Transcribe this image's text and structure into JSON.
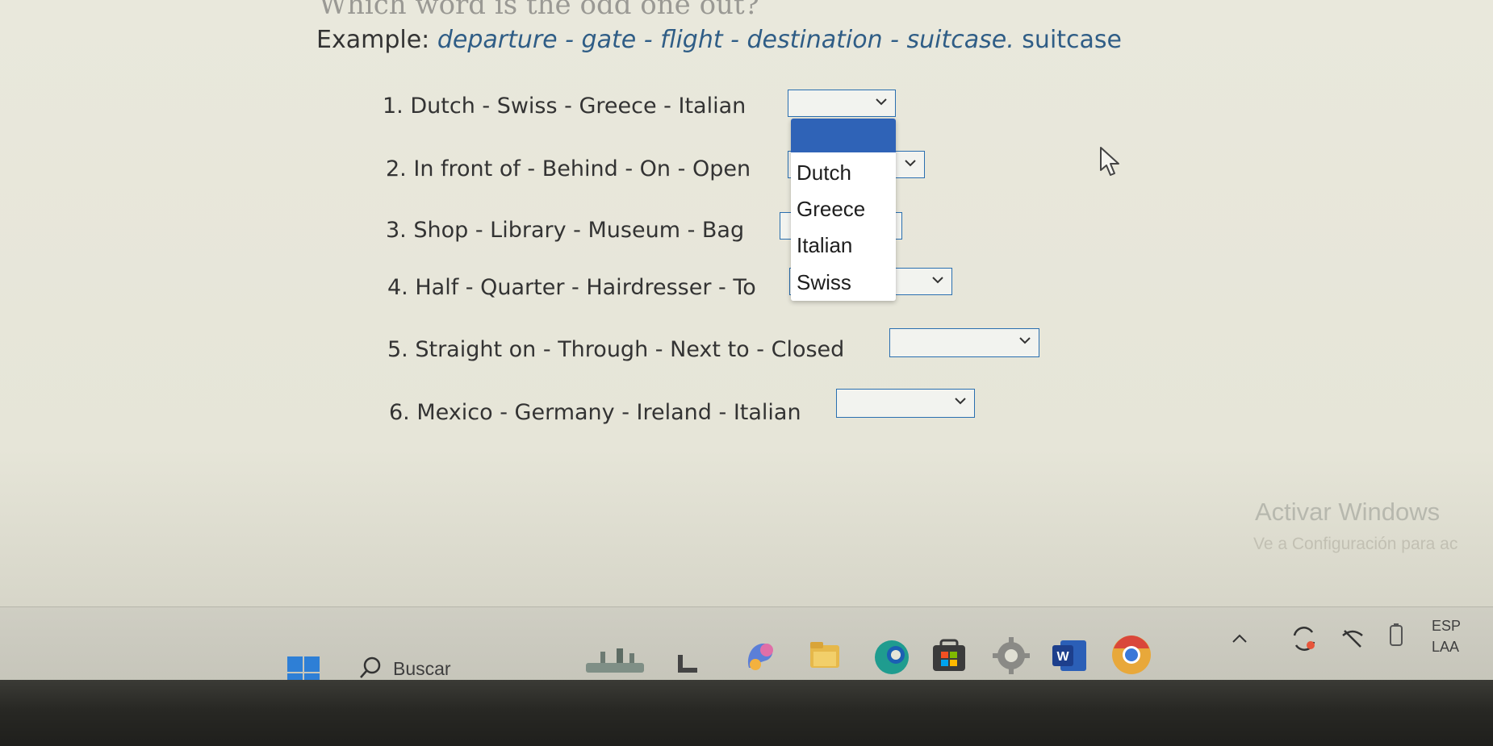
{
  "header_partial": "Which word is the odd one out?",
  "example": {
    "prefix": "Example:",
    "words": "departure - gate - flight - destination - suitcase.",
    "answer": "suitcase"
  },
  "questions": [
    {
      "number": "1.",
      "text": "Dutch - Swiss - Greece - Italian",
      "selected": ""
    },
    {
      "number": "2.",
      "text": "In front of - Behind - On - Open",
      "selected": ""
    },
    {
      "number": "3.",
      "text": "Shop - Library - Museum - Bag",
      "selected": ""
    },
    {
      "number": "4.",
      "text": "Half - Quarter - Hairdresser - To",
      "selected": ""
    },
    {
      "number": "5.",
      "text": "Straight on - Through - Next to - Closed",
      "selected": ""
    },
    {
      "number": "6.",
      "text": "Mexico - Germany - Ireland - Italian",
      "selected": ""
    }
  ],
  "dropdown_options": [
    "",
    "Dutch",
    "Greece",
    "Italian",
    "Swiss"
  ],
  "watermark": {
    "title": "Activar Windows",
    "subtitle": "Ve a Configuración para ac"
  },
  "taskbar": {
    "search_placeholder": "Buscar",
    "language": "ESP",
    "layout": "LAA"
  },
  "colors": {
    "select_border": "#2a6fb0",
    "highlight": "#2f63b7",
    "example_blue": "#2f5d86"
  }
}
